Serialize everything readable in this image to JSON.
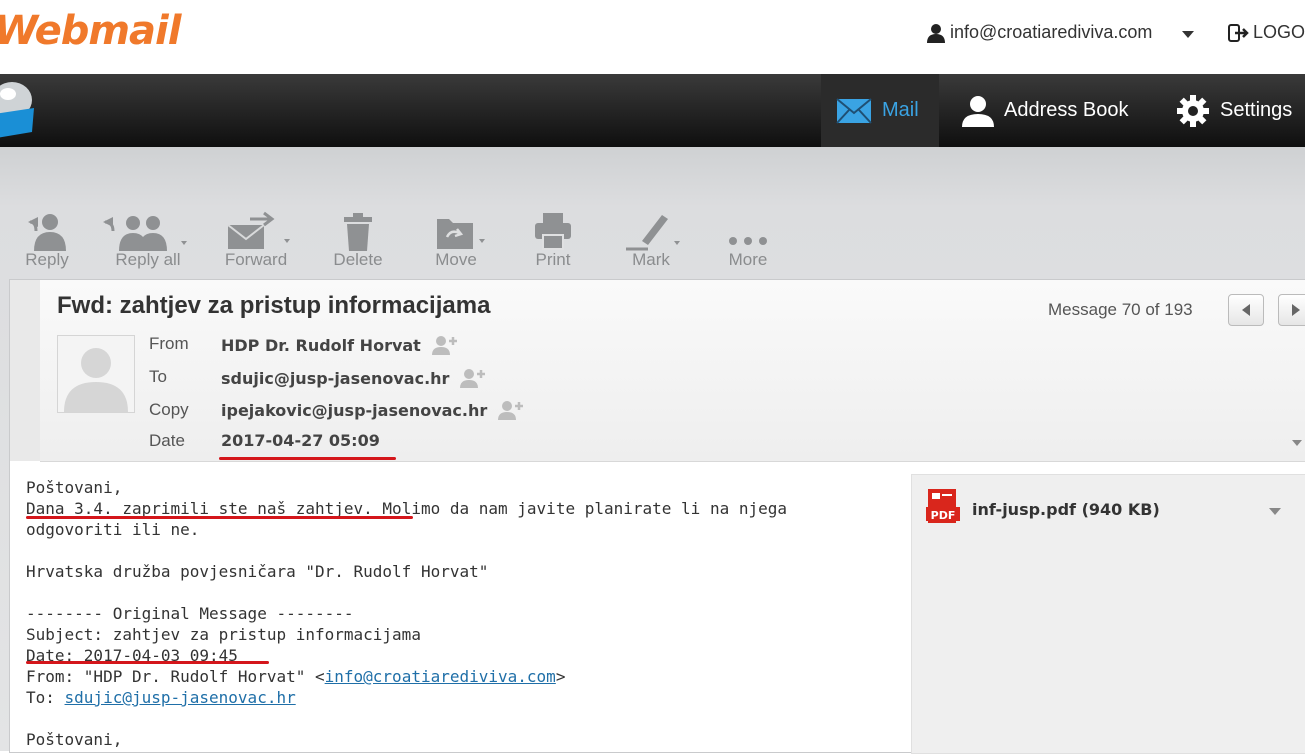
{
  "header": {
    "logo": "Webmail",
    "user_email": "info@croatiarediviva.com",
    "logout_label": "LOGO"
  },
  "nav": {
    "tabs": [
      {
        "label": "Mail",
        "icon": "envelope-icon",
        "active": true
      },
      {
        "label": "Address Book",
        "icon": "contact-icon",
        "active": false
      },
      {
        "label": "Settings",
        "icon": "gear-icon",
        "active": false
      }
    ]
  },
  "toolbar": {
    "reply": "Reply",
    "reply_all": "Reply all",
    "forward": "Forward",
    "delete": "Delete",
    "move": "Move",
    "print": "Print",
    "mark": "Mark",
    "more": "More"
  },
  "message": {
    "subject": "Fwd: zahtjev za pristup informacijama",
    "counter": "Message 70 of 193",
    "labels": {
      "from": "From",
      "to": "To",
      "copy": "Copy",
      "date": "Date"
    },
    "from": "HDP Dr. Rudolf Horvat",
    "to": "sdujic@jusp-jasenovac.hr",
    "copy": "ipejakovic@jusp-jasenovac.hr",
    "date": "2017-04-27 05:09",
    "body": {
      "l1": "Poštovani,",
      "l2a": "Dana 3.4. zaprimili ste naš zahtjev",
      "l2b": ". Molimo da nam javite planirate li na njega",
      "l3": "odgovoriti ili ne.",
      "l5": "Hrvatska družba povjesničara \"Dr. Rudolf Horvat\"",
      "l7": "-------- Original Message --------",
      "l8": "Subject: zahtjev za pristup informacijama",
      "l9": "Date: 2017-04-03 09:45",
      "l10a": "From: \"HDP Dr. Rudolf Horvat\" <",
      "l10link": "info@croatiarediviva.com",
      "l10b": ">",
      "l11a": "To: ",
      "l11link": "sdujic@jusp-jasenovac.hr",
      "l13": "Poštovani,"
    },
    "attachment": {
      "name": "inf-jusp.pdf (940 KB)",
      "icon_text": "PDF"
    }
  },
  "colors": {
    "accent": "#3aa3e3",
    "logo": "#f0792b",
    "annotation": "#d4161b"
  }
}
